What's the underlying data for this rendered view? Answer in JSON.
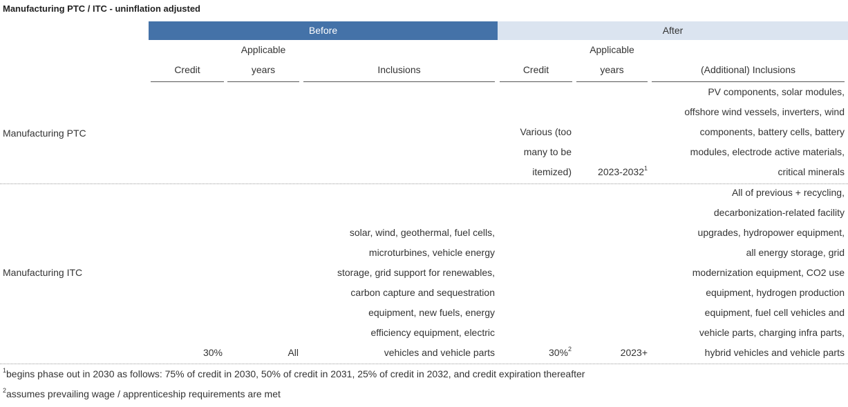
{
  "title": "Manufacturing PTC / ITC - uninflation adjusted",
  "groups": {
    "before": "Before",
    "after": "After"
  },
  "headers": {
    "before_credit": "Credit",
    "before_years_l1": "Applicable",
    "before_years_l2": "years",
    "before_inclusions": "Inclusions",
    "after_credit": "Credit",
    "after_years_l1": "Applicable",
    "after_years_l2": "years",
    "after_inclusions": "(Additional) Inclusions"
  },
  "rows": [
    {
      "label": "Manufacturing PTC",
      "before_credit": "",
      "before_years": "",
      "before_inclusions": [],
      "after_credit": [
        "Various (too",
        "many to be",
        "itemized)"
      ],
      "after_years": "2023-2032",
      "after_years_note": "1",
      "after_credit_note": "",
      "after_inclusions": [
        "PV components, solar modules,",
        "offshore wind vessels, inverters, wind",
        "components, battery cells, battery",
        "modules, electrode active materials,",
        "critical minerals"
      ]
    },
    {
      "label": "Manufacturing ITC",
      "before_credit": "30%",
      "before_years": "All",
      "before_inclusions": [
        "solar, wind, geothermal, fuel cells,",
        "microturbines, vehicle energy",
        "storage, grid support for renewables,",
        "carbon capture and sequestration",
        "equipment, new fuels, energy",
        "efficiency equipment, electric",
        "vehicles and vehicle parts"
      ],
      "after_credit": [
        "30%"
      ],
      "after_credit_note": "2",
      "after_years": "2023+",
      "after_years_note": "",
      "after_inclusions": [
        "All of previous + recycling,",
        "decarbonization-related facility",
        "upgrades, hydropower equipment,",
        "all energy storage, grid",
        "modernization equipment, CO2 use",
        "equipment, hydrogen production",
        "equipment, fuel cell vehicles and",
        "vehicle parts, charging infra parts,",
        "hybrid vehicles and vehicle parts"
      ]
    }
  ],
  "footnotes": [
    {
      "mark": "1",
      "text": "begins phase out in 2030 as follows: 75% of credit in 2030, 50% of credit in 2031, 25% of credit in 2032, and credit expiration thereafter"
    },
    {
      "mark": "2",
      "text": "assumes prevailing wage / apprenticeship requirements are met"
    }
  ]
}
